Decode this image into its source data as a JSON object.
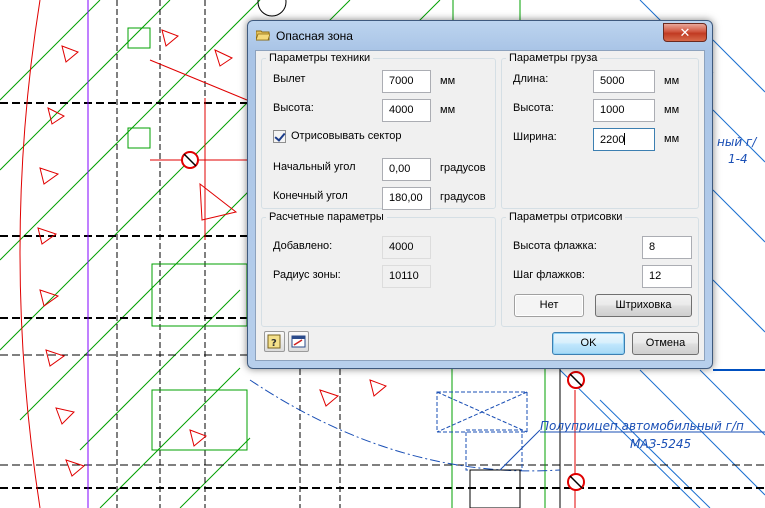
{
  "window": {
    "title": "Опасная зона",
    "close_glyph": "✕"
  },
  "machine_params": {
    "group_title": "Параметры техники",
    "reach_label": "Вылет",
    "reach_value": "7000",
    "reach_unit": "мм",
    "height_label": "Высота:",
    "height_value": "4000",
    "height_unit": "мм",
    "draw_sector_label": "Отрисовывать сектор",
    "draw_sector_checked": true,
    "start_angle_label": "Начальный угол",
    "start_angle_value": "0,00",
    "start_angle_unit": "градусов",
    "end_angle_label": "Конечный угол",
    "end_angle_value": "180,00",
    "end_angle_unit": "градусов"
  },
  "cargo_params": {
    "group_title": "Параметры груза",
    "length_label": "Длина:",
    "length_value": "5000",
    "length_unit": "мм",
    "height_label": "Высота:",
    "height_value": "1000",
    "height_unit": "мм",
    "width_label": "Ширина:",
    "width_value": "2200",
    "width_unit": "мм"
  },
  "calc_params": {
    "group_title": "Расчетные параметры",
    "added_label": "Добавлено:",
    "added_value": "4000",
    "radius_label": "Радиус зоны:",
    "radius_value": "10110"
  },
  "draw_params": {
    "group_title": "Параметры отрисовки",
    "flag_height_label": "Высота флажка:",
    "flag_height_value": "8",
    "flag_step_label": "Шаг флажков:",
    "flag_step_value": "12",
    "hatch_state": "Нет",
    "hatch_button": "Штриховка"
  },
  "footer": {
    "ok": "OK",
    "cancel": "Отмена",
    "help_icon": "help-icon",
    "pick_icon": "pick-icon"
  },
  "drawing": {
    "label_line1": "Полуприцеп автомобильный г/п",
    "label_line2": "МАЗ-5245",
    "label_partial": "ный г/",
    "label_partial2": "1-4",
    "colors": {
      "red": "#e00000",
      "green": "#00a000",
      "blue": "#1a4fb5",
      "black": "#000000",
      "magenta": "#8000ff"
    }
  }
}
